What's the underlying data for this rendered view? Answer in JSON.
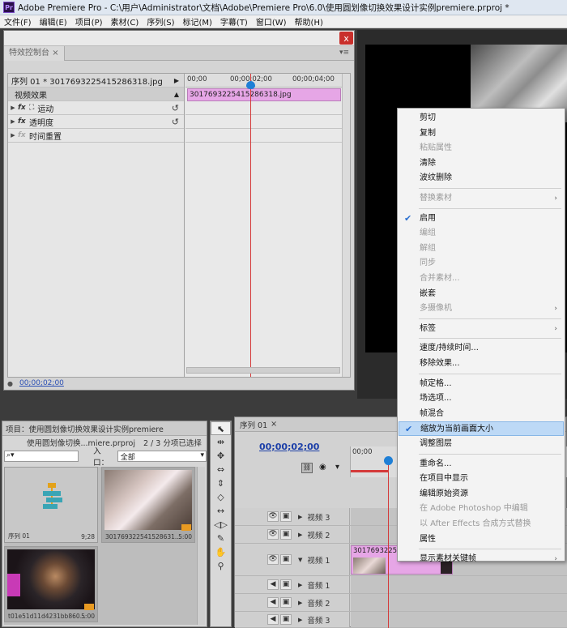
{
  "window": {
    "title": "Adobe Premiere Pro - C:\\用户\\Administrator\\文档\\Adobe\\Premiere Pro\\6.0\\使用圆划像切换效果设计实例premiere.prproj *",
    "logo": "Pr"
  },
  "menubar": [
    "文件(F)",
    "编辑(E)",
    "项目(P)",
    "素材(C)",
    "序列(S)",
    "标记(M)",
    "字幕(T)",
    "窗口(W)",
    "帮助(H)"
  ],
  "effect_controls": {
    "tab_label": "特效控制台",
    "tab_close": "×",
    "tab_menu": "▾≡",
    "close": "x",
    "header": "序列 01 * 30176932254152863​18.jpg",
    "section": "视频效果",
    "rows": [
      {
        "label": "运动",
        "fx": "fx"
      },
      {
        "label": "透明度",
        "fx": "fx"
      },
      {
        "label": "时间重置",
        "fx": "fx"
      }
    ],
    "reset_glyph": "↺",
    "ruler": [
      "00;00",
      "00;00;02;00",
      "00;00;04;00"
    ],
    "clip": "30176932254152863​18.jpg",
    "timecode": "00;00;02;00"
  },
  "project": {
    "tab": "项目：使用圆划像切换效果设计实例premiere",
    "info_name": "使用圆划像切换...miere.prproj",
    "info_count": "2 / 3 分项已选择",
    "search_glyph": "⌕▾",
    "entry_label": "入口：",
    "entry_value": "全部",
    "items": [
      {
        "name": "序列 01",
        "duration": "9;28"
      },
      {
        "name": "30176932254152863​1...",
        "duration": "5:00"
      },
      {
        "name": "t01e51d11d4231bb860...",
        "duration": "5:00"
      }
    ]
  },
  "tools": [
    "⬉",
    "⇹",
    "✥",
    "⇔",
    "⇕",
    "◇",
    "↔",
    "◁▷",
    "✎",
    "✋",
    "⚲"
  ],
  "timeline": {
    "tab": "序列 01",
    "tab_close": "×",
    "timecode": "00;00;02;00",
    "ruler": [
      "00;00"
    ],
    "tracks": [
      {
        "label": "视频 3",
        "type": "video"
      },
      {
        "label": "视频 2",
        "type": "video"
      },
      {
        "label": "视频 1",
        "type": "video"
      },
      {
        "label": "音频 1",
        "type": "audio"
      },
      {
        "label": "音频 2",
        "type": "audio"
      },
      {
        "label": "音频 3",
        "type": "audio"
      }
    ],
    "clip_label": "30176932254"
  },
  "context_menu": [
    {
      "label": "剪切",
      "disabled": false
    },
    {
      "label": "复制",
      "disabled": false
    },
    {
      "label": "粘贴属性",
      "disabled": true
    },
    {
      "label": "清除",
      "disabled": false
    },
    {
      "label": "波纹删除",
      "disabled": false
    },
    {
      "sep": true
    },
    {
      "label": "替换素材",
      "disabled": true,
      "submenu": true
    },
    {
      "sep": true
    },
    {
      "label": "启用",
      "disabled": false,
      "checked": true
    },
    {
      "label": "编组",
      "disabled": true
    },
    {
      "label": "解组",
      "disabled": true
    },
    {
      "label": "同步",
      "disabled": true
    },
    {
      "label": "合并素材...",
      "disabled": true
    },
    {
      "label": "嵌套",
      "disabled": false
    },
    {
      "label": "多摄像机",
      "disabled": true,
      "submenu": true
    },
    {
      "sep": true
    },
    {
      "label": "标签",
      "disabled": false,
      "submenu": true
    },
    {
      "sep": true
    },
    {
      "label": "速度/持续时间...",
      "disabled": false
    },
    {
      "label": "移除效果...",
      "disabled": false
    },
    {
      "sep": true
    },
    {
      "label": "帧定格...",
      "disabled": false
    },
    {
      "label": "场选项...",
      "disabled": false
    },
    {
      "label": "帧混合",
      "disabled": false
    },
    {
      "label": "缩放为当前画面大小",
      "disabled": false,
      "checked": true,
      "highlighted": true
    },
    {
      "label": "调整图层",
      "disabled": false
    },
    {
      "sep": true
    },
    {
      "label": "重命名...",
      "disabled": false
    },
    {
      "label": "在项目中显示",
      "disabled": false
    },
    {
      "label": "编辑原始资源",
      "disabled": false
    },
    {
      "label": "在 Adobe Photoshop 中编辑",
      "disabled": true
    },
    {
      "label": "以 After Effects 合成方式替换",
      "disabled": true
    },
    {
      "label": "属性",
      "disabled": false
    },
    {
      "sep": true
    },
    {
      "label": "显示素材关键帧",
      "disabled": false,
      "submenu": true
    }
  ],
  "colors": {
    "clip_pink": "#e6a6e6",
    "playhead_blue": "#1e7fd6",
    "playline_red": "#d43a3a",
    "highlight": "#bdd9f6"
  }
}
